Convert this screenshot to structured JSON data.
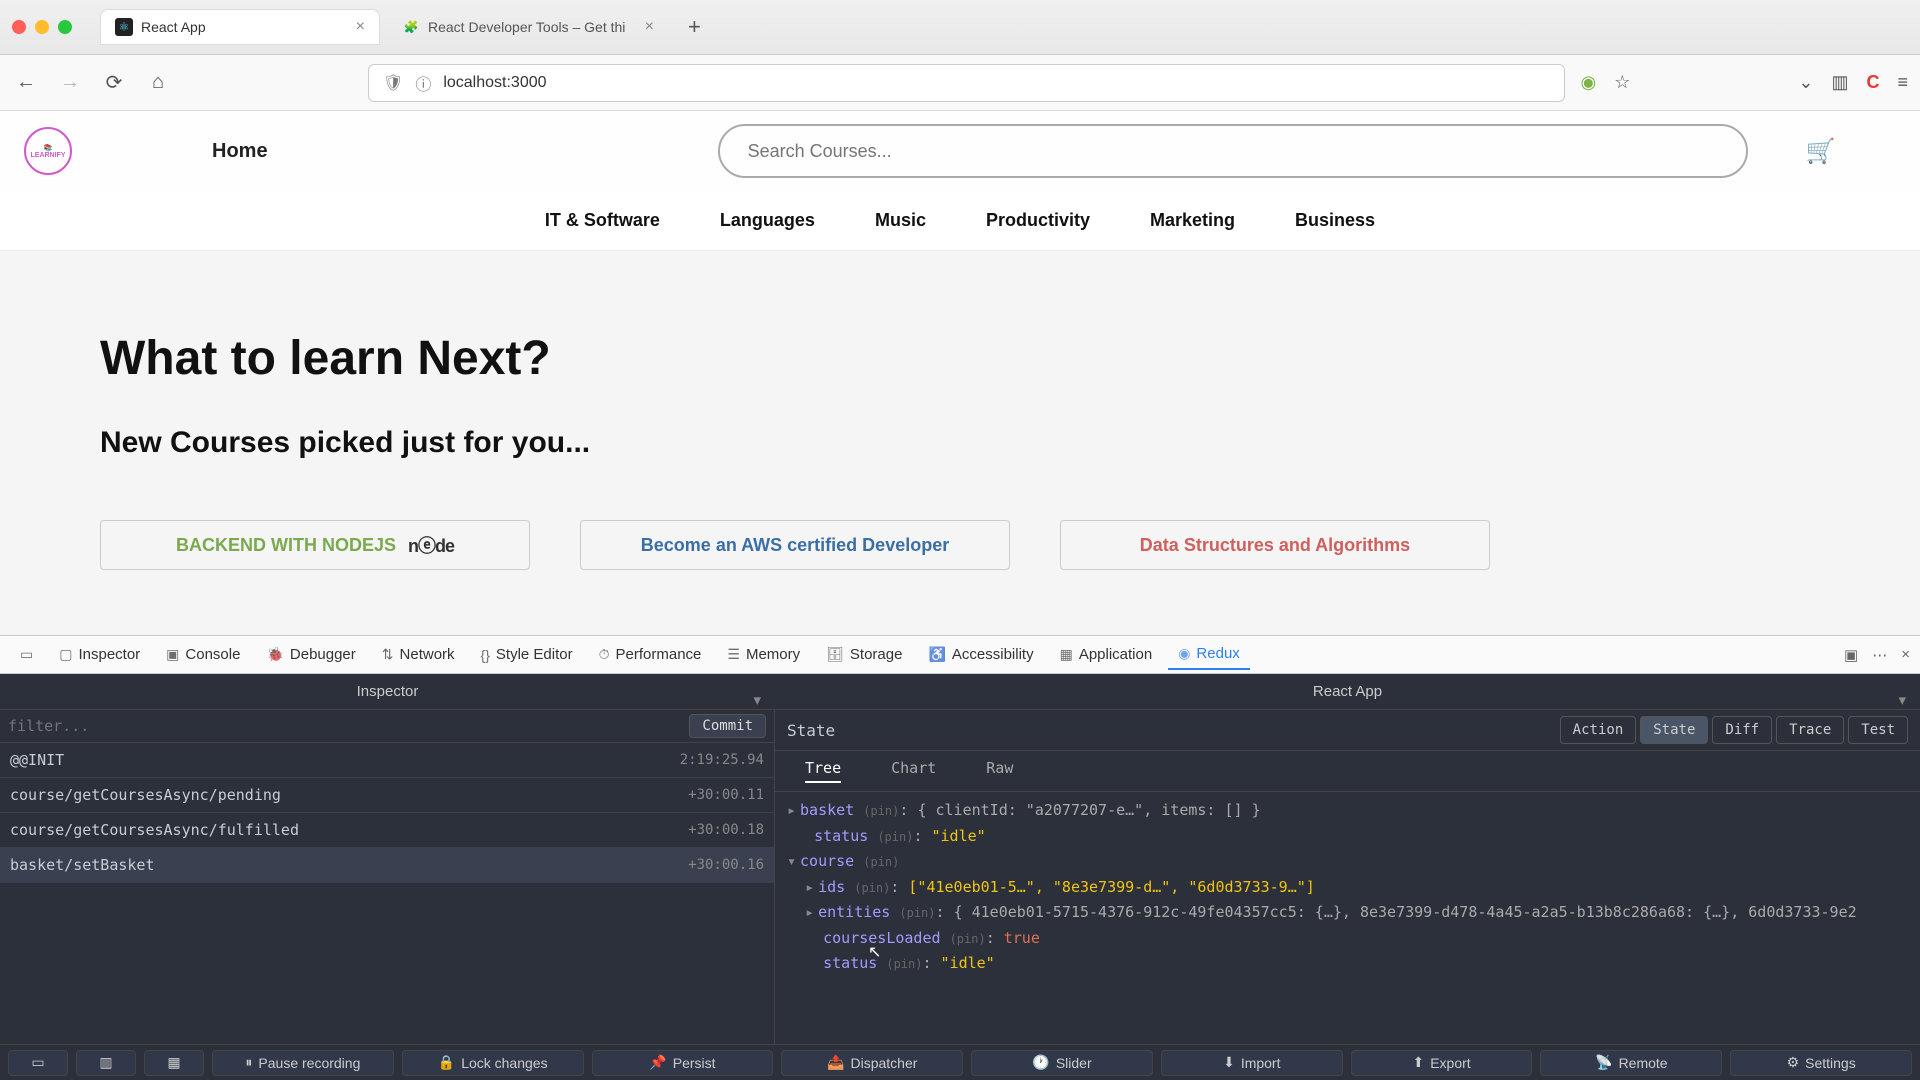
{
  "chrome": {
    "tab1": {
      "title": "React App",
      "favicon": "⚛"
    },
    "tab2": {
      "title": "React Developer Tools – Get thi",
      "favicon": "🧩"
    },
    "url": "localhost:3000"
  },
  "site": {
    "logo": "LEARNIFY",
    "home": "Home",
    "search_placeholder": "Search Courses...",
    "categories": [
      "IT & Software",
      "Languages",
      "Music",
      "Productivity",
      "Marketing",
      "Business"
    ],
    "h1": "What to learn Next?",
    "h2": "New Courses picked just for you...",
    "cards": [
      {
        "title": "BACKEND WITH NODEJS",
        "extra": "nⓔde"
      },
      {
        "title": "Become an AWS certified Developer"
      },
      {
        "title": "Data Structures and Algorithms"
      }
    ]
  },
  "devtools": {
    "tabs": [
      "Inspector",
      "Console",
      "Debugger",
      "Network",
      "Style Editor",
      "Performance",
      "Memory",
      "Storage",
      "Accessibility",
      "Application",
      "Redux"
    ],
    "sub1": "Inspector",
    "sub2": "React App",
    "filter_placeholder": "filter...",
    "commit": "Commit",
    "actions": [
      {
        "name": "@@INIT",
        "time": "2:19:25.94"
      },
      {
        "name": "course/getCoursesAsync/pending",
        "time": "+30:00.11"
      },
      {
        "name": "course/getCoursesAsync/fulfilled",
        "time": "+30:00.18"
      },
      {
        "name": "basket/setBasket",
        "time": "+30:00.16"
      }
    ],
    "state_title": "State",
    "state_btns": [
      "Action",
      "State",
      "Diff",
      "Trace",
      "Test"
    ],
    "state_active": "State",
    "view_tabs": [
      "Tree",
      "Chart",
      "Raw"
    ],
    "view_active": "Tree",
    "tree": {
      "basket_line": "{ clientId: \"a2077207-e…\", items: [] }",
      "status1": "\"idle\"",
      "ids": "[\"41e0eb01-5…\", \"8e3e7399-d…\", \"6d0d3733-9…\"]",
      "entities": "{ 41e0eb01-5715-4376-912c-49fe04357cc5: {…}, 8e3e7399-d478-4a45-a2a5-b13b8c286a68: {…}, 6d0d3733-9e2",
      "coursesLoaded": "true",
      "status2": "\"idle\""
    },
    "footer": [
      "Pause recording",
      "Lock changes",
      "Persist",
      "Dispatcher",
      "Slider",
      "Import",
      "Export",
      "Remote",
      "Settings"
    ]
  }
}
